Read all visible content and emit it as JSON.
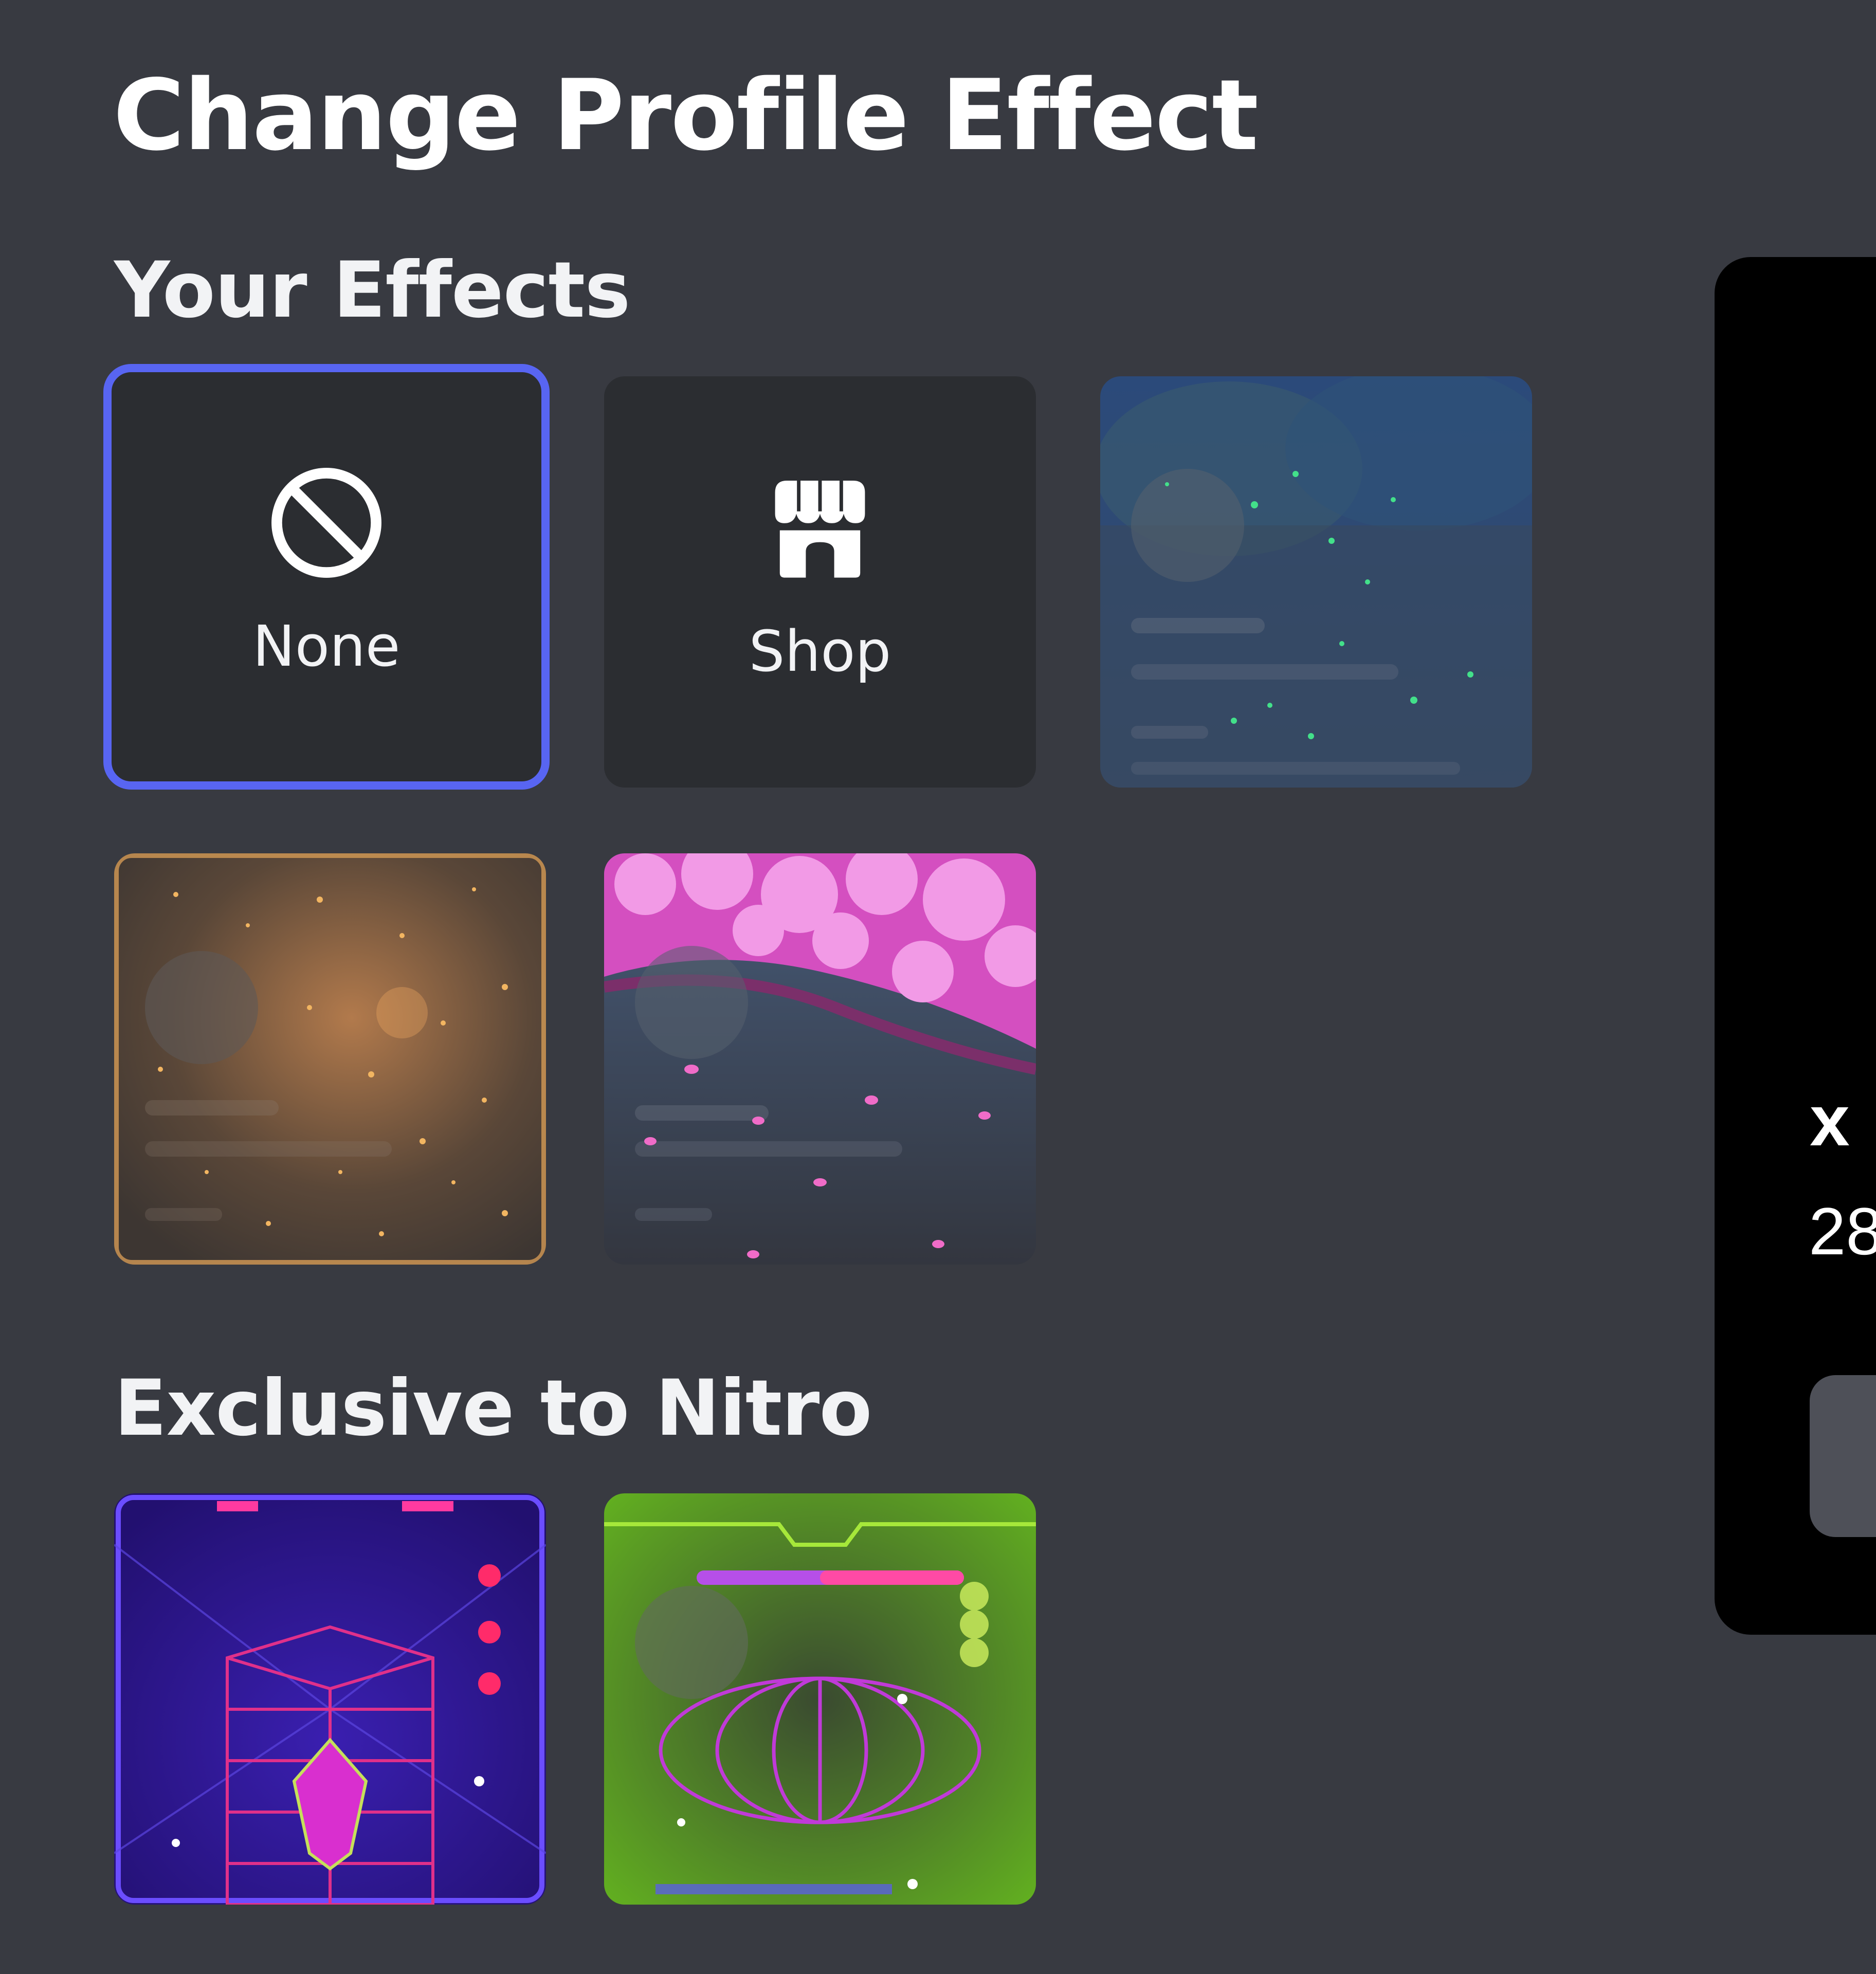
{
  "page": {
    "title": "Change Profile Effect"
  },
  "sections": {
    "your_effects": {
      "heading": "Your Effects"
    },
    "exclusive": {
      "heading": "Exclusive to Nitro"
    }
  },
  "tiles": {
    "none": {
      "label": "None",
      "icon": "ban-icon",
      "selected": true
    },
    "shop": {
      "label": "Shop",
      "icon": "shop-icon",
      "selected": false
    },
    "effects": [
      {
        "icon": "fireflies-effect"
      },
      {
        "icon": "golden-sparkles-effect"
      },
      {
        "icon": "cherry-blossom-effect"
      }
    ],
    "nitro_effects": [
      {
        "icon": "arcade-crystal-effect"
      },
      {
        "icon": "retro-game-green-effect"
      }
    ]
  },
  "preview": {
    "name": "x",
    "subtext": "28"
  },
  "colors": {
    "background": "#383a41",
    "tile": "#2b2d31",
    "accent": "#5865f2",
    "preview_bg": "#000000"
  }
}
